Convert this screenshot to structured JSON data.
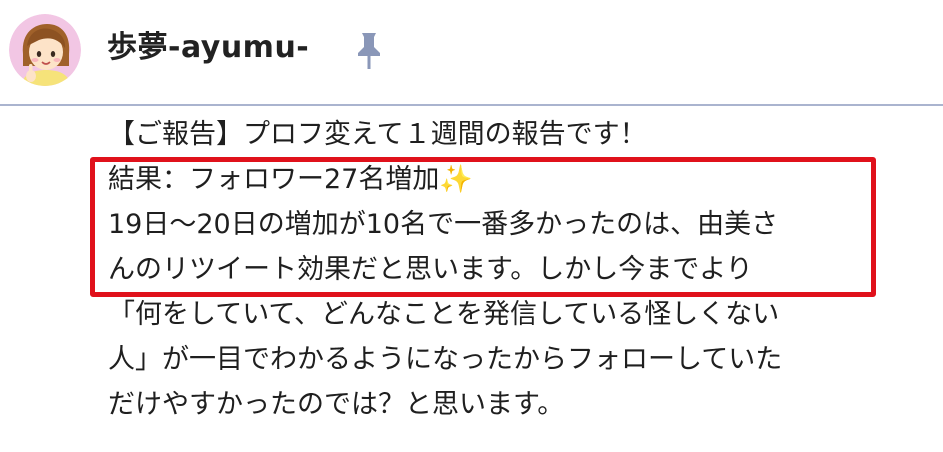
{
  "header": {
    "username": "歩夢-ayumu-",
    "avatar_icon": "avatar-illustration",
    "pin_icon": "pin-icon",
    "colors": {
      "divider": "#aab4cf",
      "pin": "#8a97b8",
      "highlight_border": "#e0111b"
    }
  },
  "post": {
    "lines": [
      "【ご報告】プロフ変えて１週間の報告です！",
      "結果：フォロワー27名増加✨",
      "19日〜20日の増加が10名で一番多かったのは、由美さ",
      "んのリツイート効果だと思います。しかし今までより",
      "「何をしていて、どんなことを発信している怪しくない",
      "人」が一目でわかるようになったからフォローしていた",
      "だけやすかったのでは？と思います。"
    ]
  }
}
